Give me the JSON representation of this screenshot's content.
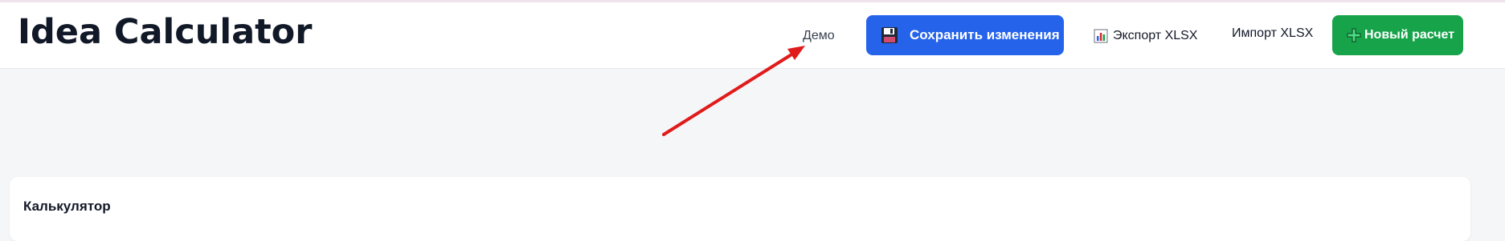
{
  "header": {
    "title": "Idea Calculator",
    "demo_label": "Демо",
    "save_label": "Сохранить изменения",
    "export_label": "Экспорт XLSX",
    "import_label": "Импорт XLSX",
    "new_label": "Новый расчет"
  },
  "main": {
    "card_title": "Калькулятор"
  },
  "colors": {
    "save_button": "#2563eb",
    "new_button": "#16a34a",
    "annotation_arrow": "#e01b1b"
  },
  "icons": {
    "save": "floppy-disk-icon",
    "export": "bar-chart-icon",
    "new": "plus-icon"
  }
}
